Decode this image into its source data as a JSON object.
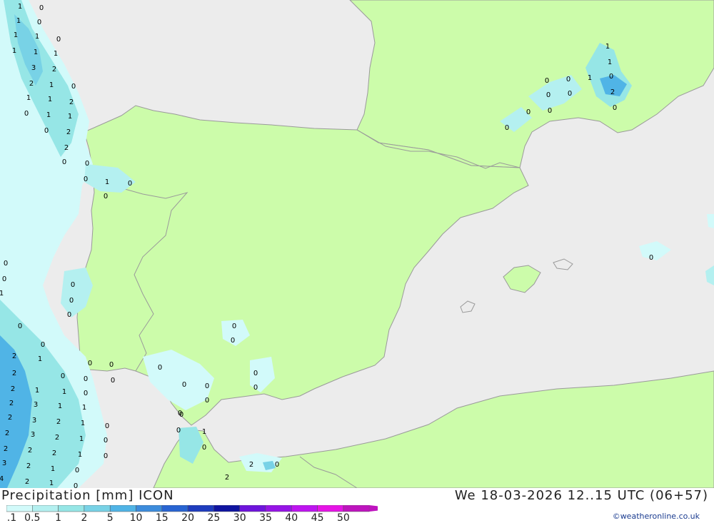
{
  "header": {
    "title": "Precipitation [mm] ICON",
    "valid_time": "We 18-03-2026 12..15 UTC (06+57)",
    "credit": "©weatheronline.co.uk"
  },
  "legend": {
    "labels": [
      "0.1",
      "0.5",
      "1",
      "2",
      "5",
      "10",
      "15",
      "20",
      "25",
      "30",
      "35",
      "40",
      "45",
      "50"
    ],
    "colors": [
      "#d2fafa",
      "#b4f0f0",
      "#96e6e6",
      "#78d2e6",
      "#50b4e6",
      "#3c8cdc",
      "#2864d2",
      "#1e3cbe",
      "#0f14a0",
      "#6e14dc",
      "#9614e6",
      "#be14f0",
      "#e614e6",
      "#be14be"
    ]
  },
  "colors": {
    "sea": "#ececec",
    "land": "#ccfcaa",
    "border": "#9a9a9a"
  },
  "map": {
    "labels": [
      {
        "v": "1"
      },
      {
        "v": "0"
      },
      {
        "v": "1"
      },
      {
        "v": "0"
      },
      {
        "v": "1"
      },
      {
        "v": "1"
      },
      {
        "v": "0"
      },
      {
        "v": "1"
      },
      {
        "v": "1"
      },
      {
        "v": "1"
      },
      {
        "v": "3"
      },
      {
        "v": "2"
      },
      {
        "v": "2"
      },
      {
        "v": "1"
      },
      {
        "v": "0"
      },
      {
        "v": "1"
      },
      {
        "v": "1"
      },
      {
        "v": "2"
      },
      {
        "v": "0"
      },
      {
        "v": "1"
      },
      {
        "v": "1"
      },
      {
        "v": "0"
      },
      {
        "v": "2"
      },
      {
        "v": "2"
      },
      {
        "v": "0"
      },
      {
        "v": "0"
      },
      {
        "v": "0"
      },
      {
        "v": "1"
      },
      {
        "v": "0"
      },
      {
        "v": "0"
      },
      {
        "v": "1"
      },
      {
        "v": "1"
      },
      {
        "v": "0"
      },
      {
        "v": "0"
      },
      {
        "v": "1"
      },
      {
        "v": "0"
      },
      {
        "v": "0"
      },
      {
        "v": "2"
      },
      {
        "v": "0"
      },
      {
        "v": "0"
      },
      {
        "v": "0"
      },
      {
        "v": "0"
      },
      {
        "v": "0"
      },
      {
        "v": "0"
      },
      {
        "v": "0"
      },
      {
        "v": "0"
      },
      {
        "v": "1"
      },
      {
        "v": "0"
      },
      {
        "v": "0"
      },
      {
        "v": "0"
      },
      {
        "v": "0"
      },
      {
        "v": "0"
      },
      {
        "v": "0"
      },
      {
        "v": "0"
      },
      {
        "v": "0"
      },
      {
        "v": "2"
      },
      {
        "v": "0"
      },
      {
        "v": "0"
      },
      {
        "v": "0"
      },
      {
        "v": "0"
      },
      {
        "v": "0"
      },
      {
        "v": "0"
      },
      {
        "v": "0"
      },
      {
        "v": "0"
      },
      {
        "v": "0"
      },
      {
        "v": "2"
      },
      {
        "v": "1"
      },
      {
        "v": "0"
      },
      {
        "v": "0"
      },
      {
        "v": "1"
      },
      {
        "v": "2"
      },
      {
        "v": "2"
      },
      {
        "v": "1"
      },
      {
        "v": "0"
      },
      {
        "v": "2"
      },
      {
        "v": "3"
      },
      {
        "v": "1"
      },
      {
        "v": "1"
      },
      {
        "v": "2"
      },
      {
        "v": "3"
      },
      {
        "v": "2"
      },
      {
        "v": "1"
      },
      {
        "v": "0"
      },
      {
        "v": "2"
      },
      {
        "v": "3"
      },
      {
        "v": "2"
      },
      {
        "v": "1"
      },
      {
        "v": "0"
      },
      {
        "v": "2"
      },
      {
        "v": "2"
      },
      {
        "v": "2"
      },
      {
        "v": "1"
      },
      {
        "v": "0"
      },
      {
        "v": "3"
      },
      {
        "v": "2"
      },
      {
        "v": "1"
      },
      {
        "v": "0"
      },
      {
        "v": "4"
      },
      {
        "v": "2"
      },
      {
        "v": "1"
      },
      {
        "v": "0"
      },
      {
        "v": "0"
      },
      {
        "v": "1"
      },
      {
        "v": "0"
      },
      {
        "v": "2"
      },
      {
        "v": "0"
      },
      {
        "v": "0"
      }
    ]
  }
}
